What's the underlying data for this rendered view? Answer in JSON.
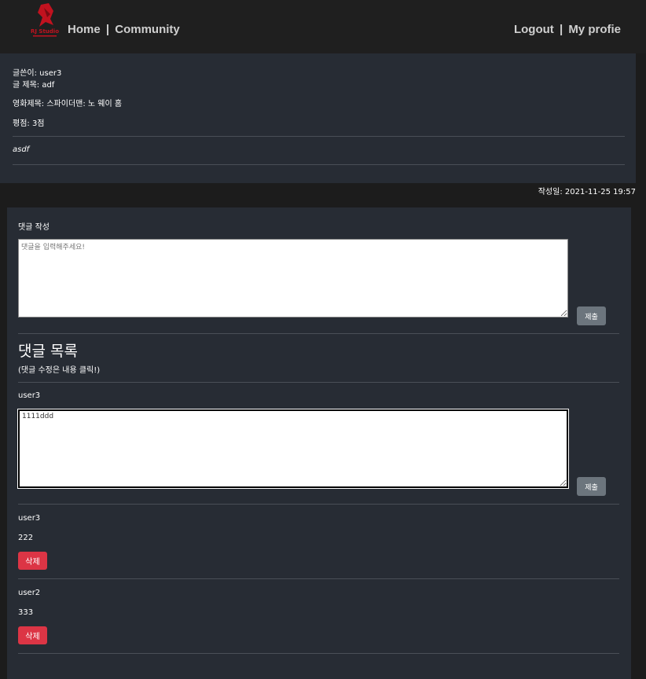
{
  "nav": {
    "logo_text": "RJ Studio",
    "home": "Home",
    "community": "Community",
    "separator": "|",
    "logout": "Logout",
    "profile": "My profie"
  },
  "post": {
    "author_line": "글쓴이: user3",
    "title_line": "글 제목: adf",
    "movie_line": "영화제목: 스파이더맨: 노 웨이 홈",
    "rating_line": "평점: 3점",
    "body": "asdf",
    "date_line": "작성일: 2021-11-25 19:57"
  },
  "comment_form": {
    "label": "댓글 작성",
    "placeholder": "댓글을 입력해주세요!",
    "submit": "제출"
  },
  "comment_list": {
    "title": "댓글 목록",
    "hint": "(댓글 수정은 내용 클릭!)",
    "editing": {
      "author": "user3",
      "value": "1111ddd",
      "submit": "제출"
    },
    "items": [
      {
        "author": "user3",
        "content": "222",
        "delete": "삭제"
      },
      {
        "author": "user2",
        "content": "333",
        "delete": "삭제"
      }
    ]
  }
}
